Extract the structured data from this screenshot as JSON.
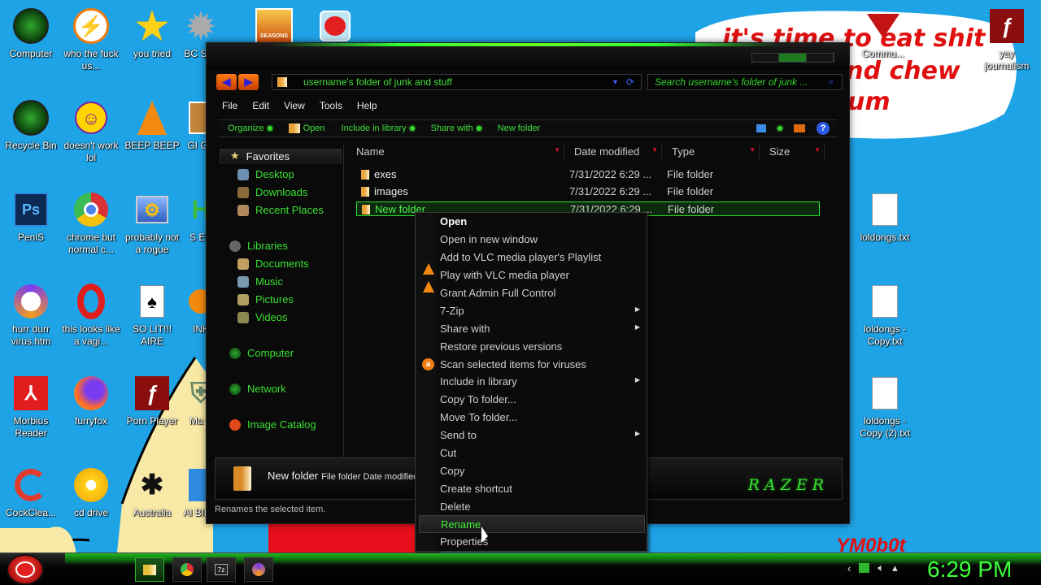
{
  "colors": {
    "desktop": "#1ea3e6",
    "accent_green": "#3be033",
    "selection": "#2de02d"
  },
  "wallpaper": {
    "bubble_line1": "it's time to eat shit",
    "bubble_line2": "and chew",
    "bubble_line3": "um",
    "signature": "YM0b0t"
  },
  "desktop_icons": [
    {
      "label": "Computer",
      "icon": "computer-icon"
    },
    {
      "label": "who the fuck us...",
      "icon": "avast-icon"
    },
    {
      "label": "you tried",
      "icon": "star-icon"
    },
    {
      "label": "BC SIM",
      "icon": "virus-icon"
    },
    {
      "label": "SEASONS",
      "icon": "seasons-icon"
    },
    {
      "label": "",
      "icon": "angry-bird-icon"
    },
    {
      "label": "Recycle Bin",
      "icon": "recycle-bin-icon"
    },
    {
      "label": "doesn't work lol",
      "icon": "yahoo-icon"
    },
    {
      "label": "BEEP BEEP",
      "icon": "vlc-icon"
    },
    {
      "label": "GI GA",
      "icon": "app-icon"
    },
    {
      "label": "PeniS",
      "icon": "photoshop-icon"
    },
    {
      "label": "chrome but normal c...",
      "icon": "chrome-icon"
    },
    {
      "label": "probably not a rogue",
      "icon": "settings-icon"
    },
    {
      "label": "S ED",
      "icon": "app-icon"
    },
    {
      "label": "hurr durr virus.htm",
      "icon": "browser-icon"
    },
    {
      "label": "this looks like a vagi...",
      "icon": "opera-icon"
    },
    {
      "label": "SO LIT!!! AIRE",
      "icon": "cards-icon"
    },
    {
      "label": "INK",
      "icon": "app-icon"
    },
    {
      "label": "Morbius Reader",
      "icon": "pdf-icon"
    },
    {
      "label": "furryfox",
      "icon": "firefox-icon"
    },
    {
      "label": "Porn Player",
      "icon": "flash-icon"
    },
    {
      "label": "Ma E",
      "icon": "shield-icon"
    },
    {
      "label": "CockClea...",
      "icon": "ccleaner-icon"
    },
    {
      "label": "cd drive",
      "icon": "cd-icon"
    },
    {
      "label": "Australia",
      "icon": "spider-icon"
    },
    {
      "label": "Al BIRD",
      "icon": "app-icon"
    },
    {
      "label": "Commu...",
      "icon": "community-icon"
    },
    {
      "label": "yay journalism",
      "icon": "flash-icon"
    },
    {
      "label": "loldongs.txt",
      "icon": "text-file-icon"
    },
    {
      "label": "loldongs - Copy.txt",
      "icon": "text-file-icon"
    },
    {
      "label": "loldongs - Copy (2).txt",
      "icon": "text-file-icon"
    }
  ],
  "explorer": {
    "address": "username's folder of junk and stuff",
    "search_placeholder": "Search username's folder of junk ...",
    "menu": [
      "File",
      "Edit",
      "View",
      "Tools",
      "Help"
    ],
    "commands": [
      "Organize",
      "Open",
      "Include in library",
      "Share with",
      "New folder"
    ],
    "nav": {
      "favorites": "Favorites",
      "fav_items": [
        "Desktop",
        "Downloads",
        "Recent Places"
      ],
      "libraries": "Libraries",
      "lib_items": [
        "Documents",
        "Music",
        "Pictures",
        "Videos"
      ],
      "computer": "Computer",
      "network": "Network",
      "image_catalog": "Image Catalog"
    },
    "columns": [
      "Name",
      "Date modified",
      "Type",
      "Size"
    ],
    "files": [
      {
        "name": "exes",
        "date": "7/31/2022 6:29 ...",
        "type": "File folder"
      },
      {
        "name": "images",
        "date": "7/31/2022 6:29 ...",
        "type": "File folder"
      },
      {
        "name": "New folder",
        "date": "7/31/2022 6:29 ...",
        "type": "File folder"
      }
    ],
    "details": {
      "name": "New folder",
      "meta": "File folder Date modified"
    },
    "brand": "RAZER",
    "status": "Renames the selected item."
  },
  "context_menu": [
    {
      "label": "Open",
      "bold": true
    },
    {
      "label": "Open in new window"
    },
    {
      "label": "Add to VLC media player's Playlist",
      "icon": "vlc-icon"
    },
    {
      "label": "Play with VLC media player",
      "icon": "vlc-icon"
    },
    {
      "label": "Grant Admin Full Control"
    },
    {
      "label": "7-Zip",
      "submenu": true
    },
    {
      "label": "Share with",
      "submenu": true
    },
    {
      "label": "Restore previous versions"
    },
    {
      "label": "Scan selected items for viruses",
      "icon": "avast-icon"
    },
    {
      "label": "Include in library",
      "submenu": true
    },
    {
      "label": "Copy To folder..."
    },
    {
      "label": "Move To folder..."
    },
    {
      "label": "Send to",
      "submenu": true
    },
    {
      "label": "Cut"
    },
    {
      "label": "Copy"
    },
    {
      "label": "Create shortcut"
    },
    {
      "label": "Delete"
    },
    {
      "label": "Rename",
      "highlighted": true
    },
    {
      "label": "Properties"
    }
  ],
  "taskbar": {
    "start": "start-orb",
    "clock": "6:29 PM"
  }
}
